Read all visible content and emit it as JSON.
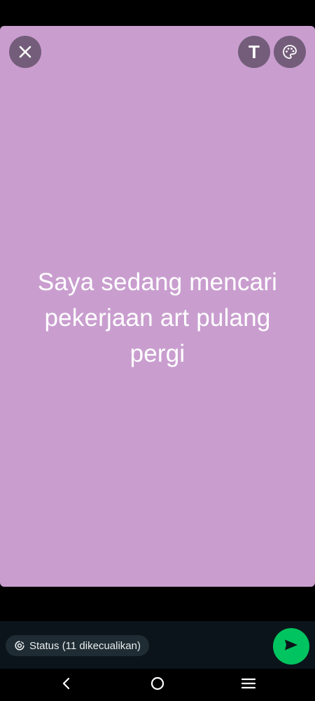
{
  "canvas": {
    "background_color": "#c99ecf",
    "text": "Saya sedang mencari pekerjaan art pulang pergi",
    "text_color": "#ffffff"
  },
  "toolbar": {
    "close_icon": "close-icon",
    "text_tool_label": "T",
    "palette_icon": "palette-icon"
  },
  "footer": {
    "audience_label": "Status (11 dikecualikan)",
    "audience_icon": "status-icon",
    "send_icon": "send-icon",
    "send_color": "#00c45f"
  },
  "nav": {
    "back_icon": "back-icon",
    "home_icon": "home-icon",
    "recents_icon": "recents-icon"
  }
}
